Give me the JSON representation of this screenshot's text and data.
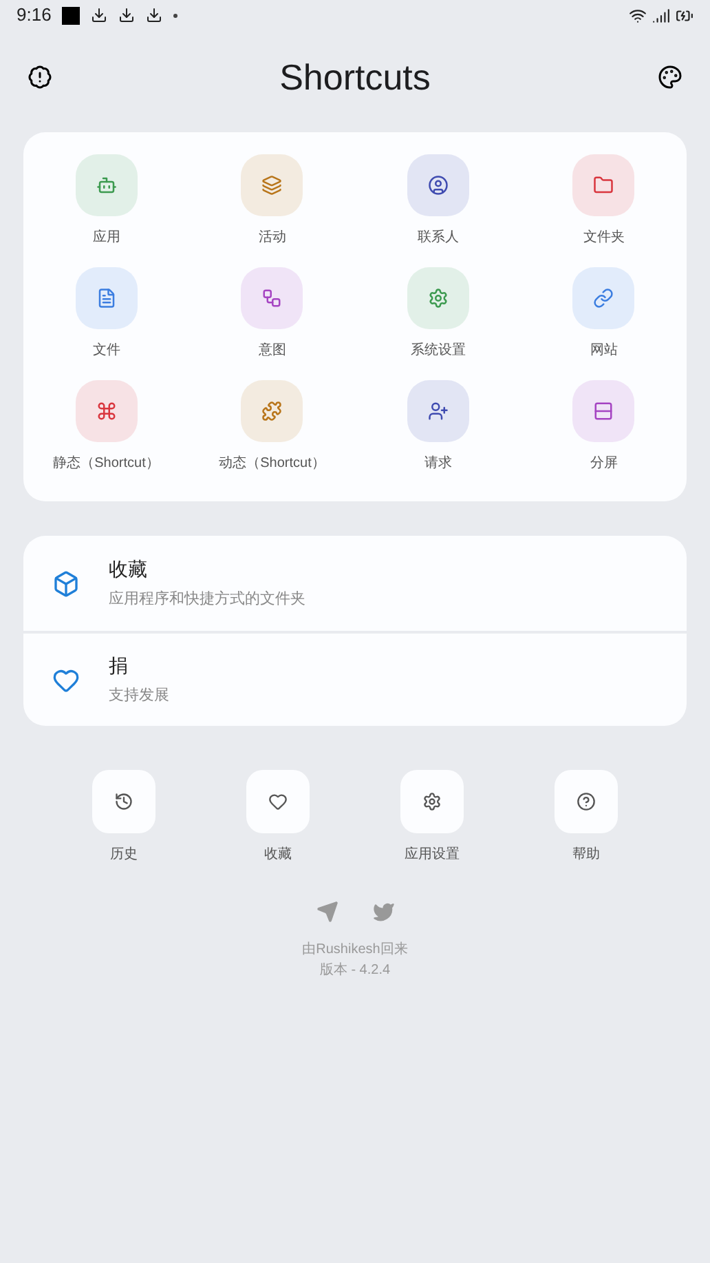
{
  "status_bar": {
    "time": "9:16"
  },
  "header": {
    "title": "Shortcuts"
  },
  "shortcuts": [
    {
      "kind": "app",
      "label": "应用",
      "color": "#3c9a4f"
    },
    {
      "kind": "activity",
      "label": "活动",
      "color": "#b8751a"
    },
    {
      "kind": "contact",
      "label": "联系人",
      "color": "#3f4bb0"
    },
    {
      "kind": "folder",
      "label": "文件夹",
      "color": "#d9363e"
    },
    {
      "kind": "file",
      "label": "文件",
      "color": "#3b7de0"
    },
    {
      "kind": "intent",
      "label": "意图",
      "color": "#a544c2"
    },
    {
      "kind": "system",
      "label": "系统设置",
      "color": "#3c9a4f"
    },
    {
      "kind": "website",
      "label": "网站",
      "color": "#3b7de0"
    },
    {
      "kind": "static",
      "label": "静态（Shortcut）",
      "color": "#d9363e"
    },
    {
      "kind": "dynamic",
      "label": "动态（Shortcut）",
      "color": "#b8751a"
    },
    {
      "kind": "request",
      "label": "请求",
      "color": "#3f4bb0"
    },
    {
      "kind": "split",
      "label": "分屏",
      "color": "#a544c2"
    }
  ],
  "menu": [
    {
      "kind": "box",
      "title": "收藏",
      "subtitle": "应用程序和快捷方式的文件夹"
    },
    {
      "kind": "heart",
      "title": "捐",
      "subtitle": "支持发展"
    }
  ],
  "quick_actions": [
    {
      "kind": "history",
      "label": "历史"
    },
    {
      "kind": "heart",
      "label": "收藏"
    },
    {
      "kind": "settings",
      "label": "应用设置"
    },
    {
      "kind": "help",
      "label": "帮助"
    }
  ],
  "footer": {
    "credit": "由Rushikesh回来",
    "version": "版本 - 4.2.4"
  }
}
